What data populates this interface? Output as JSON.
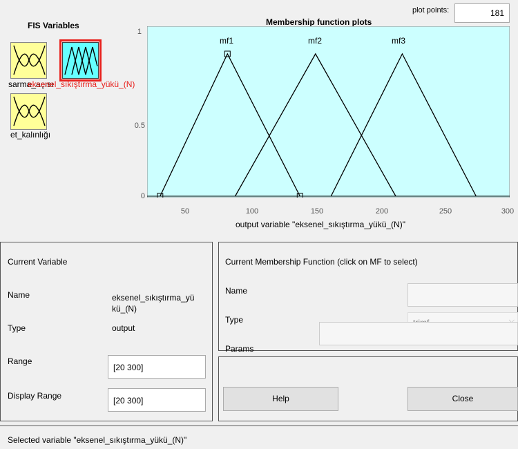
{
  "fis_variables": {
    "title": "FIS Variables",
    "inputs": [
      {
        "label": "sarma_açısı"
      },
      {
        "label": "et_kalınlığı"
      }
    ],
    "output": {
      "label": "eksenel_sıkıştırma_yükü_(N)"
    }
  },
  "plot": {
    "title": "Membership function plots",
    "plot_points_label": "plot points:",
    "plot_points_value": "181",
    "xlabel": "output variable \"eksenel_sıkıştırma_yükü_(N)\""
  },
  "chart_data": {
    "type": "line",
    "title": "Membership function plots",
    "xlabel": "output variable \"eksenel_sıkıştırma_yükü_(N)\"",
    "xlim": [
      20,
      300
    ],
    "ylim": [
      0,
      1
    ],
    "x_ticks": [
      "50",
      "100",
      "150",
      "200",
      "250",
      "300"
    ],
    "y_ticks": [
      "0",
      "0.5",
      "1"
    ],
    "series": [
      {
        "name": "mf1",
        "type": "trimf",
        "x": [
          30,
          82,
          138
        ],
        "y": [
          0,
          1,
          0
        ]
      },
      {
        "name": "mf2",
        "type": "trimf",
        "x": [
          88,
          150,
          212
        ],
        "y": [
          0,
          1,
          0
        ]
      },
      {
        "name": "mf3",
        "type": "trimf",
        "x": [
          162,
          217,
          274
        ],
        "y": [
          0,
          1,
          0
        ]
      }
    ],
    "background": "#ccffff"
  },
  "current_variable": {
    "title": "Current Variable",
    "name_label": "Name",
    "name_value_line1": "eksenel_sıkıştırma_yü",
    "name_value_line2": "kü_(N)",
    "type_label": "Type",
    "type_value": "output",
    "range_label": "Range",
    "range_value": "[20 300]",
    "display_range_label": "Display Range",
    "display_range_value": "[20 300]"
  },
  "current_mf": {
    "title": "Current Membership Function (click on MF to select)",
    "name_label": "Name",
    "name_value": "",
    "type_label": "Type",
    "type_value": "trimf",
    "params_label": "Params",
    "params_value": ""
  },
  "buttons": {
    "help": "Help",
    "close": "Close"
  },
  "status": {
    "text": "Selected variable \"eksenel_sıkıştırma_yükü_(N)\""
  },
  "colors": {
    "input_icon": "#ffff99",
    "output_icon": "#66ffff",
    "selected_outline": "#e8201c",
    "plot_bg": "#ccffff"
  }
}
